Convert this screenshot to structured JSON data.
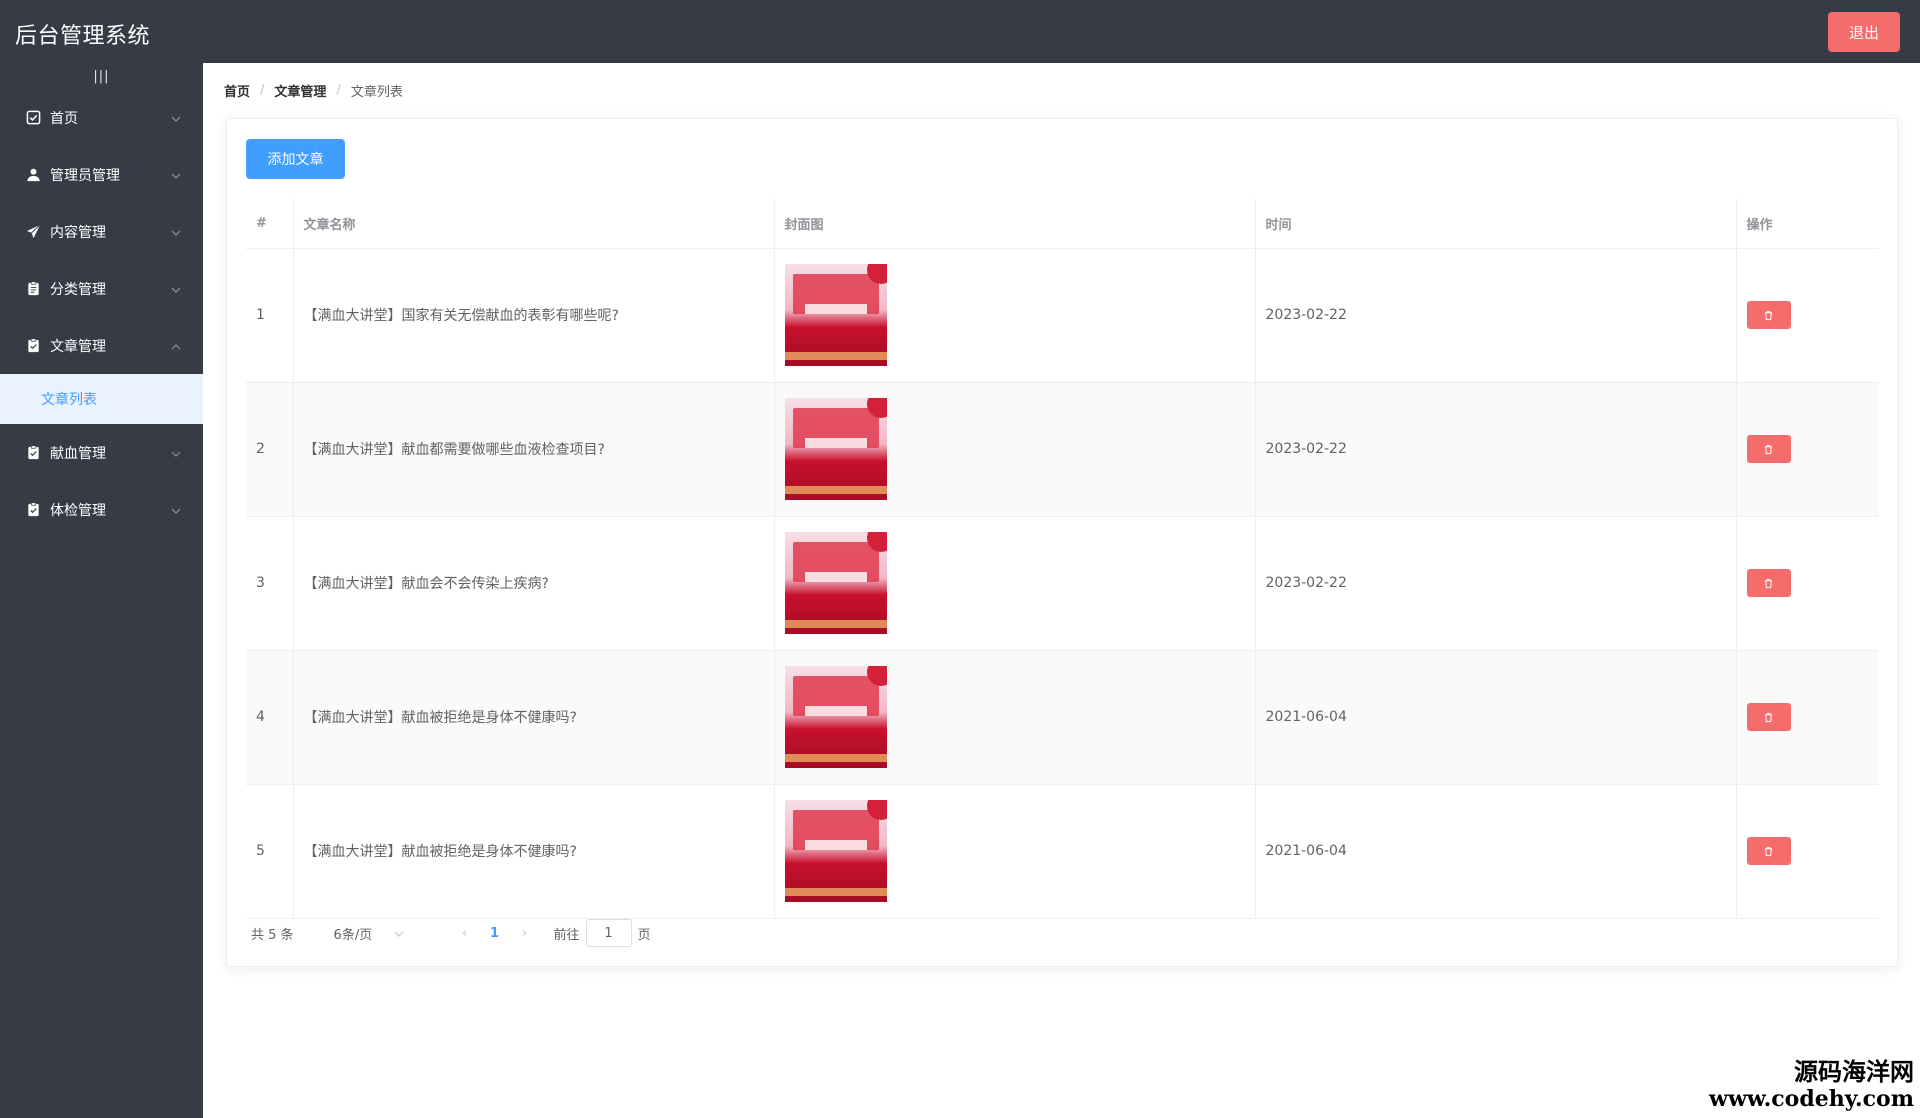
{
  "header": {
    "title": "后台管理系统",
    "logout_label": "退出"
  },
  "sidebar": {
    "collapse_glyph": "|||",
    "items": [
      {
        "label": "首页",
        "icon": "home-icon",
        "expanded": false
      },
      {
        "label": "管理员管理",
        "icon": "user-icon",
        "expanded": false
      },
      {
        "label": "内容管理",
        "icon": "send-icon",
        "expanded": false
      },
      {
        "label": "分类管理",
        "icon": "clipboard-icon",
        "expanded": false
      },
      {
        "label": "文章管理",
        "icon": "checklist-icon",
        "expanded": true
      },
      {
        "label": "献血管理",
        "icon": "checklist-icon",
        "expanded": false
      },
      {
        "label": "体检管理",
        "icon": "checklist-icon",
        "expanded": false
      }
    ],
    "active_submenu": {
      "label": "文章列表"
    }
  },
  "breadcrumb": {
    "home": "首页",
    "section": "文章管理",
    "current": "文章列表",
    "separator": "/"
  },
  "toolbar": {
    "add_label": "添加文章"
  },
  "table": {
    "headers": [
      "#",
      "文章名称",
      "封面图",
      "时间",
      "操作"
    ],
    "rows": [
      {
        "index": "1",
        "name": "【满血大讲堂】国家有关无偿献血的表彰有哪些呢?",
        "date": "2023-02-22"
      },
      {
        "index": "2",
        "name": "【满血大讲堂】献血都需要做哪些血液检查项目?",
        "date": "2023-02-22"
      },
      {
        "index": "3",
        "name": "【满血大讲堂】献血会不会传染上疾病?",
        "date": "2023-02-22"
      },
      {
        "index": "4",
        "name": "【满血大讲堂】献血被拒绝是身体不健康吗?",
        "date": "2021-06-04"
      },
      {
        "index": "5",
        "name": "【满血大讲堂】献血被拒绝是身体不健康吗?",
        "date": "2021-06-04"
      }
    ]
  },
  "pagination": {
    "total_text": "共 5 条",
    "page_size_text": "6条/页",
    "prev_glyph": "‹",
    "next_glyph": "›",
    "current_page": "1",
    "goto_label": "前往",
    "goto_value": "1",
    "page_suffix": "页"
  },
  "watermark": {
    "name": "源码海洋网",
    "url": "www.codehy.com"
  },
  "colors": {
    "sidebar_bg": "#363b45",
    "primary": "#409eff",
    "danger": "#f56c6c",
    "submenu_active_bg": "#e9f3fd"
  }
}
